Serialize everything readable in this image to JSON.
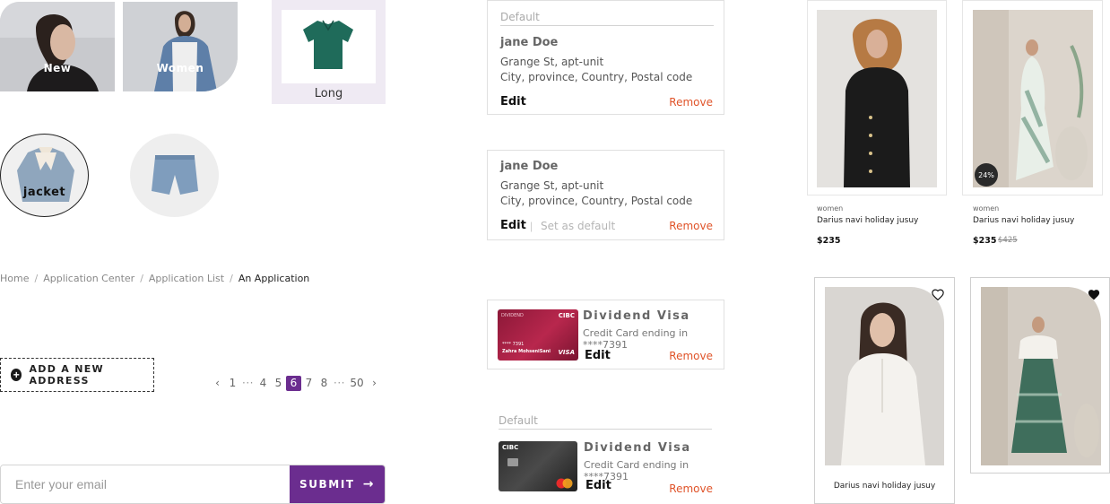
{
  "categories": {
    "new_label": "New",
    "women_label": "Women",
    "long_label": "Long",
    "jacket_label": "jacket"
  },
  "breadcrumb": {
    "items": [
      "Home",
      "Application Center",
      "Application List"
    ],
    "current": "An Application"
  },
  "add_address": {
    "label": "ADD A NEW ADDRESS",
    "icon": "plus-circle-icon"
  },
  "pagination": {
    "pages": [
      "1",
      "4",
      "5",
      "6",
      "7",
      "8",
      "50"
    ],
    "ellipsis": "···",
    "active": "6"
  },
  "subscribe": {
    "placeholder": "Enter your email",
    "button_label": "SUBMIT",
    "accent": "#6b2d8f"
  },
  "addresses": [
    {
      "default_label": "Default",
      "name": "jane Doe",
      "line1": "Grange St, apt-unit",
      "line2": "City, province, Country, Postal code",
      "edit": "Edit",
      "remove": "Remove"
    },
    {
      "name": "jane Doe",
      "line1": "Grange St, apt-unit",
      "line2": "City, province, Country, Postal code",
      "edit": "Edit",
      "set_default": "Set as default",
      "remove": "Remove"
    }
  ],
  "cards": [
    {
      "title": "Dividend Visa",
      "subtitle": "Credit Card ending in ****7391",
      "edit": "Edit",
      "remove": "Remove",
      "card_bank": "CIBC",
      "card_top": "DIVIDEND",
      "card_number": "**** 7391",
      "card_holder": "Zahra MohseniSani",
      "card_brand": "VISA"
    },
    {
      "default_label": "Default",
      "title": "Dividend Visa",
      "subtitle": "Credit Card ending in ****7391",
      "edit": "Edit",
      "remove": "Remove",
      "card_bank": "CIBC"
    }
  ],
  "products": [
    {
      "category": "women",
      "name": "Darius navi holiday jusuy",
      "price": "$235"
    },
    {
      "category": "women",
      "name": "Darius navi holiday jusuy",
      "price": "$235",
      "old_price": "$425",
      "badge": "24%"
    },
    {
      "name": "Darius navi holiday jusuy",
      "heart_icon": "heart-outline-icon"
    },
    {
      "heart_icon": "heart-filled-icon"
    }
  ],
  "colors": {
    "accent": "#6b2d8f",
    "remove": "#e0542a",
    "long_tile_bg": "#efeaf3"
  }
}
